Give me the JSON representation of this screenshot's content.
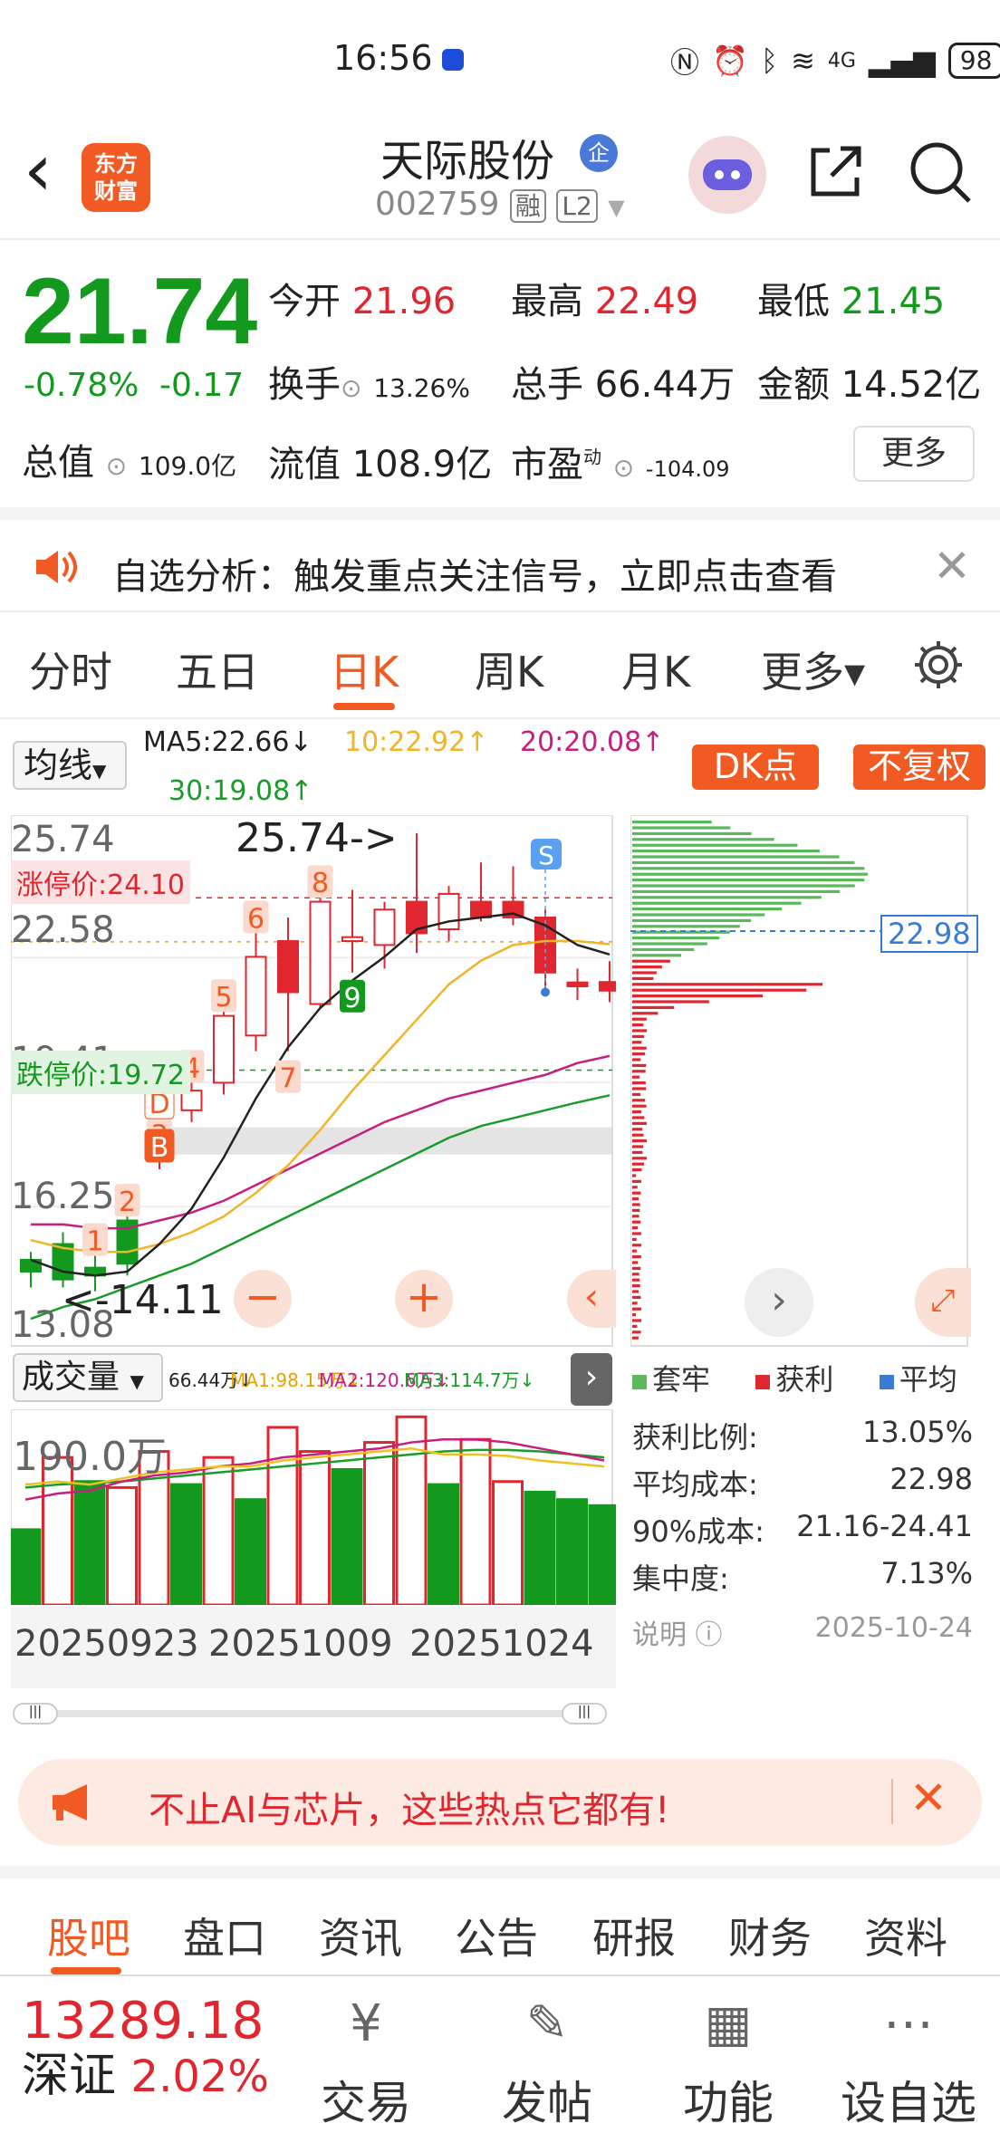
{
  "status": {
    "time": "16:56",
    "network": "4G",
    "battery": "98"
  },
  "header": {
    "back": "‹",
    "logo": "东方\n财富",
    "stock_name": "天际股份",
    "qi_badge": "企",
    "stock_code": "002759",
    "tag_rong": "融",
    "tag_l2": "L2"
  },
  "quote": {
    "price": "21.74",
    "change_pct": "-0.78%",
    "change": "-0.17",
    "open_label": "今开",
    "open": "21.96",
    "high_label": "最高",
    "high": "22.49",
    "low_label": "最低",
    "low": "21.45",
    "turnover_label": "换手",
    "turnover": "13.26%",
    "volume_label": "总手",
    "volume": "66.44万",
    "amount_label": "金额",
    "amount": "14.52亿",
    "mktcap_label": "总值",
    "mktcap": "109.0亿",
    "float_label": "流值",
    "float": "108.9亿",
    "pe_label": "市盈",
    "pe_sup": "动",
    "pe": "-104.09",
    "more": "更多"
  },
  "banner": {
    "text": "自选分析：触发重点关注信号，立即点击查看"
  },
  "period_tabs": [
    "分时",
    "五日",
    "日K",
    "周K",
    "月K",
    "更多▾"
  ],
  "chart_toolbar": {
    "ma_select": "均线",
    "ma5": "MA5:22.66↓",
    "ma10": "10:22.92↑",
    "ma20": "20:20.08↑",
    "ma30": "30:19.08↑",
    "dk": "DK点",
    "fq": "不复权",
    "colors": {
      "ma5": "#222222",
      "ma10": "#f0b429",
      "ma20": "#c81e7d",
      "ma30": "#1a9c2a"
    }
  },
  "kchart": {
    "y_labels": [
      "25.74",
      "22.58",
      "19.41",
      "16.25",
      "13.08"
    ],
    "limit_up": "涨停价:24.10",
    "limit_down": "跌停价:19.72",
    "max_annot": "25.74->",
    "min_annot": "<-14.11",
    "signal_numbers": [
      "1",
      "2",
      "3",
      "4",
      "5",
      "6",
      "7",
      "8",
      "9"
    ],
    "signal_b": "B",
    "signal_d": "D",
    "signal_s": "S"
  },
  "chart_data": {
    "type": "candlestick",
    "candles": [
      {
        "o": 14.6,
        "h": 15.1,
        "l": 14.2,
        "c": 14.9,
        "dir": "up"
      },
      {
        "o": 15.3,
        "h": 15.6,
        "l": 14.2,
        "c": 14.4,
        "dir": "down"
      },
      {
        "o": 14.5,
        "h": 15.0,
        "l": 14.1,
        "c": 14.7,
        "dir": "up"
      },
      {
        "o": 14.8,
        "h": 16.0,
        "l": 14.5,
        "c": 15.9,
        "dir": "up"
      },
      {
        "o": 17.4,
        "h": 17.7,
        "l": 17.2,
        "c": 17.5,
        "dir": "up"
      },
      {
        "o": 18.7,
        "h": 19.4,
        "l": 18.4,
        "c": 19.2,
        "dir": "up"
      },
      {
        "o": 19.4,
        "h": 21.2,
        "l": 19.1,
        "c": 21.1,
        "dir": "up"
      },
      {
        "o": 20.6,
        "h": 23.2,
        "l": 20.2,
        "c": 22.6,
        "dir": "up"
      },
      {
        "o": 23.0,
        "h": 23.6,
        "l": 20.2,
        "c": 21.7,
        "dir": "down"
      },
      {
        "o": 21.4,
        "h": 24.1,
        "l": 21.3,
        "c": 24.0,
        "dir": "up"
      },
      {
        "o": 23.0,
        "h": 24.3,
        "l": 22.2,
        "c": 23.1,
        "dir": "down"
      },
      {
        "o": 22.9,
        "h": 24.0,
        "l": 22.3,
        "c": 23.8,
        "dir": "up"
      },
      {
        "o": 24.0,
        "h": 25.74,
        "l": 22.7,
        "c": 23.2,
        "dir": "down"
      },
      {
        "o": 23.3,
        "h": 24.4,
        "l": 23.0,
        "c": 24.2,
        "dir": "up"
      },
      {
        "o": 24.0,
        "h": 25.0,
        "l": 23.5,
        "c": 23.6,
        "dir": "down"
      },
      {
        "o": 24.0,
        "h": 24.9,
        "l": 23.4,
        "c": 23.6,
        "dir": "down"
      },
      {
        "o": 23.6,
        "h": 23.8,
        "l": 21.8,
        "c": 22.2,
        "dir": "down"
      },
      {
        "o": 21.95,
        "h": 22.3,
        "l": 21.5,
        "c": 21.85,
        "dir": "down"
      },
      {
        "o": 21.96,
        "h": 22.49,
        "l": 21.45,
        "c": 21.74,
        "dir": "down"
      }
    ],
    "ylim": [
      13.08,
      25.74
    ],
    "ma5": [
      14.9,
      14.6,
      14.5,
      14.6,
      15.3,
      16.2,
      17.5,
      19.0,
      20.3,
      21.3,
      22.0,
      22.6,
      23.3,
      23.5,
      23.6,
      23.7,
      23.4,
      22.9,
      22.66
    ],
    "ma10": [
      15.4,
      15.2,
      15.1,
      15.1,
      15.3,
      15.6,
      16.0,
      16.6,
      17.3,
      18.2,
      19.2,
      20.1,
      21.0,
      21.9,
      22.5,
      22.9,
      23.0,
      23.0,
      22.92
    ],
    "ma20": [
      15.8,
      15.8,
      15.7,
      15.7,
      15.9,
      16.1,
      16.4,
      16.8,
      17.2,
      17.6,
      18.0,
      18.4,
      18.7,
      19.0,
      19.2,
      19.4,
      19.6,
      19.9,
      20.08
    ],
    "ma30": [
      13.4,
      13.7,
      13.9,
      14.2,
      14.5,
      14.8,
      15.2,
      15.6,
      16.0,
      16.4,
      16.8,
      17.2,
      17.6,
      18.0,
      18.3,
      18.5,
      18.7,
      18.9,
      19.08
    ],
    "volume": {
      "max_label": "190.0万",
      "values": [
        50,
        98,
        82,
        78,
        102,
        80,
        98,
        70,
        118,
        102,
        90,
        108,
        125,
        80,
        110,
        82,
        75,
        70,
        66
      ],
      "dirs": [
        "down",
        "up",
        "down",
        "up",
        "up",
        "down",
        "up",
        "down",
        "up",
        "up",
        "down",
        "up",
        "up",
        "down",
        "up",
        "up",
        "down",
        "down",
        "down"
      ],
      "ma1": [
        80,
        82,
        80,
        84,
        88,
        90,
        92,
        92,
        96,
        98,
        100,
        102,
        104,
        100,
        100,
        99,
        96,
        94,
        92
      ],
      "ma2": [
        70,
        74,
        76,
        82,
        86,
        88,
        92,
        94,
        98,
        100,
        102,
        104,
        108,
        110,
        110,
        108,
        104,
        100,
        96
      ],
      "ma3": [
        78,
        80,
        81,
        82,
        84,
        86,
        88,
        90,
        92,
        94,
        96,
        98,
        100,
        102,
        103,
        103,
        102,
        100,
        98
      ]
    },
    "x_labels": [
      "20250923",
      "20251009",
      "20251024"
    ]
  },
  "chips": {
    "avg_label": "22.98",
    "legend": [
      "套牢",
      "获利",
      "平均"
    ],
    "legend_colors": [
      "#5cb85c",
      "#e0262e",
      "#3a7bd5"
    ],
    "stats": [
      {
        "label": "获利比例:",
        "value": "13.05%"
      },
      {
        "label": "平均成本:",
        "value": "22.98"
      },
      {
        "label": "90%成本:",
        "value": "21.16-24.41"
      },
      {
        "label": "集中度:",
        "value": "7.13%"
      }
    ],
    "note": "说明",
    "date": "2025-10-24"
  },
  "volume_bar": {
    "select": "成交量",
    "vol": "66.44万↓",
    "ma1": "MA1:98.15万↓",
    "ma2": "MA2:120.6万↓",
    "ma3": "MA3:114.7万↓"
  },
  "promo": {
    "text": "不止AI与芯片，这些热点它都有!"
  },
  "bottom_tabs": [
    "股吧",
    "盘口",
    "资讯",
    "公告",
    "研报",
    "财务",
    "资料"
  ],
  "nav": {
    "index_value": "13289.18",
    "index_name": "深证",
    "index_change": "2.02%",
    "items": [
      "交易",
      "发帖",
      "功能",
      "设自选"
    ]
  }
}
